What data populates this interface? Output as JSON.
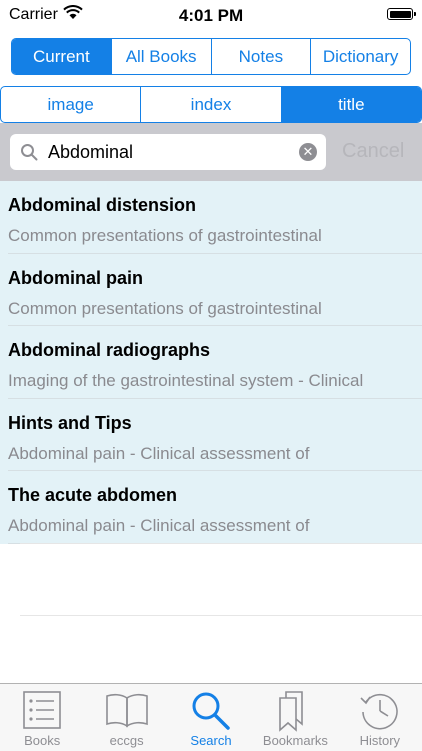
{
  "status_bar": {
    "carrier": "Carrier",
    "time": "4:01 PM"
  },
  "scope_tabs": [
    {
      "label": "Current",
      "selected": true
    },
    {
      "label": "All Books",
      "selected": false
    },
    {
      "label": "Notes",
      "selected": false
    },
    {
      "label": "Dictionary",
      "selected": false
    }
  ],
  "field_tabs": [
    {
      "label": "image",
      "selected": false
    },
    {
      "label": "index",
      "selected": false
    },
    {
      "label": "title",
      "selected": true
    }
  ],
  "search": {
    "value": "Abdominal",
    "cancel_label": "Cancel"
  },
  "results": [
    {
      "title": "Abdominal distension",
      "subtitle": "Common presentations of gastrointestinal"
    },
    {
      "title": "Abdominal pain",
      "subtitle": "Common presentations of gastrointestinal"
    },
    {
      "title": "Abdominal radiographs",
      "subtitle": "Imaging of the gastrointestinal system - Clinical"
    },
    {
      "title": "Hints and Tips",
      "subtitle": "Abdominal pain - Clinical assessment of"
    },
    {
      "title": "The acute abdomen",
      "subtitle": "Abdominal pain - Clinical assessment of"
    }
  ],
  "tab_bar": [
    {
      "label": "Books",
      "icon": "list-icon",
      "selected": false
    },
    {
      "label": "eccgs",
      "icon": "open-book-icon",
      "selected": false
    },
    {
      "label": "Search",
      "icon": "search-icon",
      "selected": true
    },
    {
      "label": "Bookmarks",
      "icon": "bookmarks-icon",
      "selected": false
    },
    {
      "label": "History",
      "icon": "clock-icon",
      "selected": false
    }
  ],
  "colors": {
    "accent": "#1480e6",
    "row_background": "#e3f2f7",
    "search_bar": "#c9c9ce",
    "secondary_text": "#8a8a8f"
  }
}
